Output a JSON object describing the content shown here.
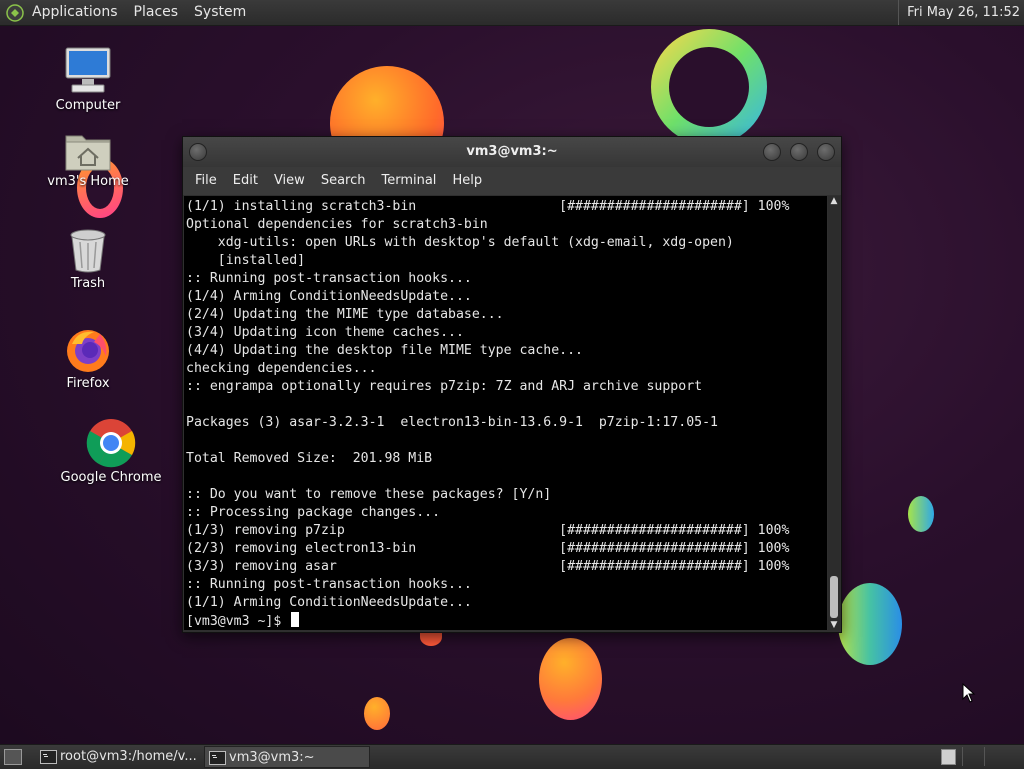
{
  "top_panel": {
    "menus": [
      "Applications",
      "Places",
      "System"
    ],
    "clock": "Fri May 26, 11:52"
  },
  "desktop_icons": [
    {
      "label": "Computer",
      "icon": "computer-icon"
    },
    {
      "label": "vm3's Home",
      "icon": "home-folder-icon"
    },
    {
      "label": "Trash",
      "icon": "trash-icon"
    },
    {
      "label": "Firefox",
      "icon": "firefox-icon"
    },
    {
      "label": "Google Chrome",
      "icon": "chrome-icon"
    }
  ],
  "terminal": {
    "title": "vm3@vm3:~",
    "menus": [
      "File",
      "Edit",
      "View",
      "Search",
      "Terminal",
      "Help"
    ],
    "lines": [
      "(1/1) installing scratch3-bin                  [######################] 100%",
      "Optional dependencies for scratch3-bin",
      "    xdg-utils: open URLs with desktop's default (xdg-email, xdg-open)",
      "    [installed]",
      ":: Running post-transaction hooks...",
      "(1/4) Arming ConditionNeedsUpdate...",
      "(2/4) Updating the MIME type database...",
      "(3/4) Updating icon theme caches...",
      "(4/4) Updating the desktop file MIME type cache...",
      "checking dependencies...",
      ":: engrampa optionally requires p7zip: 7Z and ARJ archive support",
      "",
      "Packages (3) asar-3.2.3-1  electron13-bin-13.6.9-1  p7zip-1:17.05-1",
      "",
      "Total Removed Size:  201.98 MiB",
      "",
      ":: Do you want to remove these packages? [Y/n]",
      ":: Processing package changes...",
      "(1/3) removing p7zip                           [######################] 100%",
      "(2/3) removing electron13-bin                  [######################] 100%",
      "(3/3) removing asar                            [######################] 100%",
      ":: Running post-transaction hooks...",
      "(1/1) Arming ConditionNeedsUpdate..."
    ],
    "prompt": "[vm3@vm3 ~]$ "
  },
  "taskbar": {
    "tasks": [
      {
        "label": "root@vm3:/home/v...",
        "icon": "terminal-icon"
      },
      {
        "label": "vm3@vm3:~",
        "icon": "terminal-icon"
      }
    ]
  },
  "colors": {
    "desktop_bg": "#2a0f2c",
    "panel_bg": "#333333",
    "terminal_bg": "#000000",
    "terminal_fg": "#e6e6e6"
  }
}
